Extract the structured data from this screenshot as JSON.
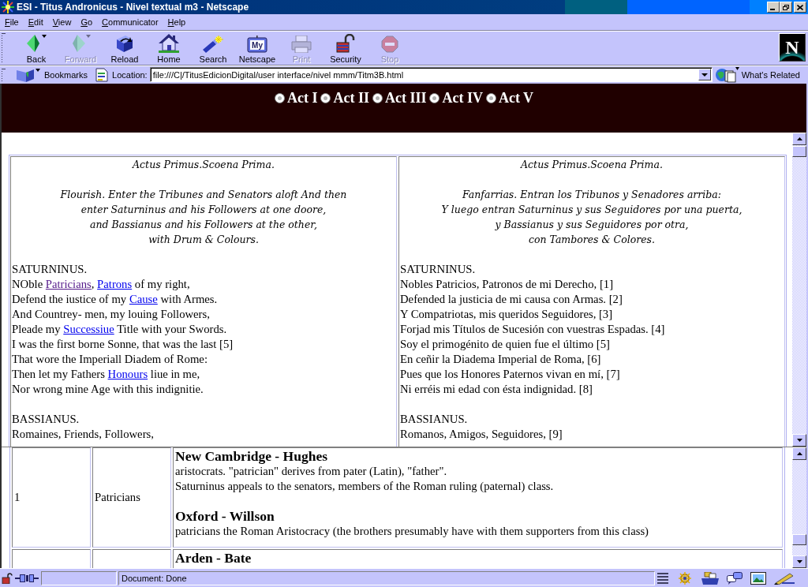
{
  "window": {
    "title": "ESI - Titus Andronicus - Nivel textual m3 - Netscape"
  },
  "menu": [
    "File",
    "Edit",
    "View",
    "Go",
    "Communicator",
    "Help"
  ],
  "toolbar": [
    {
      "kind": "back",
      "label": "Back",
      "disabled": false
    },
    {
      "kind": "forward",
      "label": "Forward",
      "disabled": true
    },
    {
      "kind": "reload",
      "label": "Reload",
      "disabled": false
    },
    {
      "kind": "home",
      "label": "Home",
      "disabled": false
    },
    {
      "kind": "search",
      "label": "Search",
      "disabled": false
    },
    {
      "kind": "portal",
      "label": "Netscape",
      "icon_text": "My",
      "disabled": false
    },
    {
      "kind": "print",
      "label": "Print",
      "disabled": true
    },
    {
      "kind": "security",
      "label": "Security",
      "disabled": false
    },
    {
      "kind": "stop",
      "label": "Stop",
      "disabled": true
    }
  ],
  "logo": {
    "text": "N"
  },
  "location_bar": {
    "bookmarks": "Bookmarks",
    "label": "Location:",
    "url": "file:///C|/TitusEdicionDigital/user interface/nivel mmm/Titm3B.html",
    "related": "What's Related"
  },
  "acts": [
    "Act I",
    "Act II",
    "Act III",
    "Act IV",
    "Act V"
  ],
  "text_table": {
    "columns": [
      {
        "heading": "Actus Primus.Scoena Prima.",
        "stage_direction": [
          "Flourish. Enter the Tribunes and Senators aloft And then",
          "enter Saturninus and his Followers at one doore,",
          "and Bassianus and his Followers at the other,",
          "with Drum & Colours."
        ],
        "speeches": [
          {
            "speaker": "SATURNINUS.",
            "lines": [
              [
                {
                  "kind": "text",
                  "text": "NOble "
                },
                {
                  "kind": "link",
                  "text": "Patricians",
                  "visited": true
                },
                {
                  "kind": "text",
                  "text": ", "
                },
                {
                  "kind": "link",
                  "text": "Patrons",
                  "visited": false
                },
                {
                  "kind": "text",
                  "text": " of my right,"
                }
              ],
              [
                {
                  "kind": "text",
                  "text": "Defend the iustice of my "
                },
                {
                  "kind": "link",
                  "text": "Cause",
                  "visited": false
                },
                {
                  "kind": "text",
                  "text": " with Armes."
                }
              ],
              [
                {
                  "kind": "text",
                  "text": "And Countrey- men, my louing Followers,"
                }
              ],
              [
                {
                  "kind": "text",
                  "text": "Pleade my "
                },
                {
                  "kind": "link",
                  "text": "Successiue",
                  "visited": false
                },
                {
                  "kind": "text",
                  "text": " Title with your Swords."
                }
              ],
              [
                {
                  "kind": "text",
                  "text": "I was the first borne Sonne, that was the last [5]"
                }
              ],
              [
                {
                  "kind": "text",
                  "text": "That wore the Imperiall Diadem of Rome:"
                }
              ],
              [
                {
                  "kind": "text",
                  "text": "Then let my Fathers "
                },
                {
                  "kind": "link",
                  "text": "Honours",
                  "visited": false
                },
                {
                  "kind": "text",
                  "text": " liue in me,"
                }
              ],
              [
                {
                  "kind": "text",
                  "text": "Nor wrong mine Age with this indignitie."
                }
              ]
            ]
          },
          {
            "speaker": "BASSIANUS.",
            "lines": [
              [
                {
                  "kind": "text",
                  "text": "Romaines, Friends, Followers,"
                }
              ]
            ]
          }
        ]
      },
      {
        "heading": "Actus Primus.Scoena Prima.",
        "stage_direction": [
          "Fanfarrias. Entran los Tribunos y Senadores arriba:",
          "Y luego entran Saturninus y sus Seguidores por una puerta,",
          "y Bassianus y sus Seguidores por otra,",
          "con Tambores & Colores."
        ],
        "speeches": [
          {
            "speaker": "SATURNINUS.",
            "lines": [
              [
                {
                  "kind": "text",
                  "text": "Nobles Patricios, Patronos de mi Derecho, [1]"
                }
              ],
              [
                {
                  "kind": "text",
                  "text": "Defended la justicia de mi causa con Armas. [2]"
                }
              ],
              [
                {
                  "kind": "text",
                  "text": "Y Compatriotas, mis queridos Seguidores, [3]"
                }
              ],
              [
                {
                  "kind": "text",
                  "text": "Forjad mis Títulos de Sucesión con vuestras Espadas. [4]"
                }
              ],
              [
                {
                  "kind": "text",
                  "text": "Soy el primogénito de quien fue el último [5]"
                }
              ],
              [
                {
                  "kind": "text",
                  "text": "En ceñir la Diadema Imperial de Roma, [6]"
                }
              ],
              [
                {
                  "kind": "text",
                  "text": "Pues que los Honores Paternos vivan en mí, [7]"
                }
              ],
              [
                {
                  "kind": "text",
                  "text": "Ni erréis mi edad con ésta indignidad. [8]"
                }
              ]
            ]
          },
          {
            "speaker": "BASSIANUS.",
            "lines": [
              [
                {
                  "kind": "text",
                  "text": "Romanos, Amigos, Seguidores, [9]"
                }
              ]
            ]
          }
        ]
      }
    ]
  },
  "notes": {
    "rows": [
      {
        "number": "1",
        "word": "Patricians",
        "entries": [
          {
            "source": "New Cambridge - Hughes",
            "text": [
              "aristocrats. \"patrician\" derives from pater (Latin), \"father\".",
              "Saturninus appeals to the senators, members of the Roman ruling (paternal) class."
            ]
          },
          {
            "source": "Oxford - Willson",
            "text": [
              "patricians the Roman Aristocracy (the brothers presumably have with them supporters from this class)"
            ]
          }
        ]
      },
      {
        "entries": [
          {
            "source": "Arden - Bate"
          }
        ]
      }
    ]
  },
  "status_bar": {
    "text": "Document: Done"
  }
}
